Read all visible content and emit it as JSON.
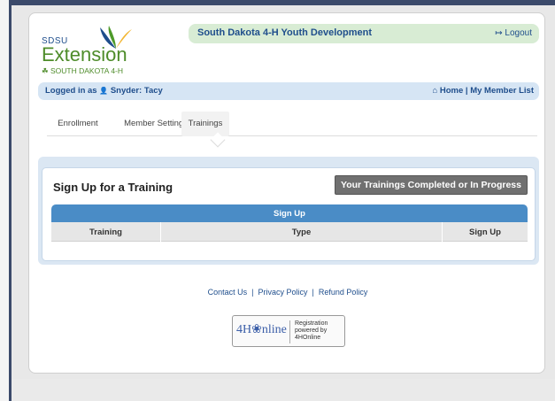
{
  "logo": {
    "sdsu": "SDSU",
    "extension": "Extension",
    "south_dakota": "SOUTH DAKOTA 4-H",
    "clover_glyph": "☘"
  },
  "header": {
    "title": "South Dakota 4-H Youth Development",
    "logout": "Logout",
    "logout_glyph": "↦"
  },
  "userbar": {
    "logged_in": "Logged in as",
    "user_glyph": "👤",
    "user": "Snyder: Tacy",
    "home_glyph": "⌂",
    "home": "Home",
    "sep": "|",
    "member_list": "My Member List"
  },
  "tabs": [
    {
      "label": "Enrollment"
    },
    {
      "label": "Member Settings"
    },
    {
      "label": "Trainings"
    }
  ],
  "panel": {
    "title": "Sign Up for a Training",
    "completed_button": "Your Trainings Completed or In Progress",
    "table_title": "Sign Up",
    "columns": [
      "Training",
      "Type",
      "Sign Up"
    ]
  },
  "footer": {
    "contact": "Contact Us",
    "sep1": "|",
    "privacy": "Privacy Policy",
    "sep2": "|",
    "refund": "Refund Policy"
  },
  "badge": {
    "logo_text": "4H❀nline",
    "line1": "Registration",
    "line2": "powered by",
    "line3": "4HOnline"
  },
  "colors": {
    "accent_blue": "#1f4e8c",
    "header_green": "#d8ecd4",
    "table_blue": "#4a8cc6"
  }
}
